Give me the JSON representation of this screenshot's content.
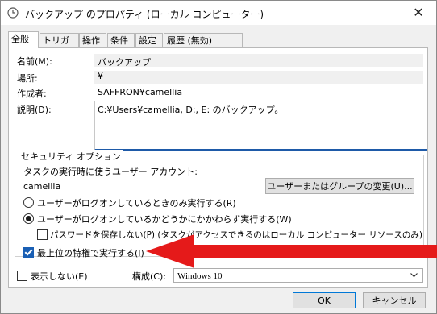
{
  "window": {
    "title": "バックアップ のプロパティ (ローカル コンピューター)",
    "close_glyph": "✕"
  },
  "tabs": [
    "全般",
    "トリガー",
    "操作",
    "条件",
    "設定",
    "履歴 (無効)"
  ],
  "general": {
    "name_label": "名前(M):",
    "name_value": "バックアップ",
    "location_label": "場所:",
    "location_value": "¥",
    "author_label": "作成者:",
    "author_value": "SAFFRON¥camellia",
    "description_label": "説明(D):",
    "description_value": "C:¥Users¥camellia, D:, E: のバックアップ。"
  },
  "security": {
    "group_title": "セキュリティ オプション",
    "account_label": "タスクの実行時に使うユーザー アカウント:",
    "account_value": "camellia",
    "change_button": "ユーザーまたはグループの変更(U)...",
    "radio_logged_on": "ユーザーがログオンしているときのみ実行する(R)",
    "radio_whether": "ユーザーがログオンしているかどうかにかかわらず実行する(W)",
    "radio_selected": "whether",
    "no_store_password": "パスワードを保存しない(P) (タスクがアクセスできるのはローカル コンピューター リソースのみ)",
    "no_store_password_checked": false,
    "highest_privileges": "最上位の特権で実行する(I)",
    "highest_privileges_checked": true
  },
  "footer": {
    "hidden_label": "表示しない(E)",
    "hidden_checked": false,
    "configure_label": "構成(C):",
    "configure_value": "Windows 10",
    "ok_button": "OK",
    "cancel_button": "キャンセル"
  },
  "annotation": {
    "arrow_color": "#e51a1a"
  }
}
